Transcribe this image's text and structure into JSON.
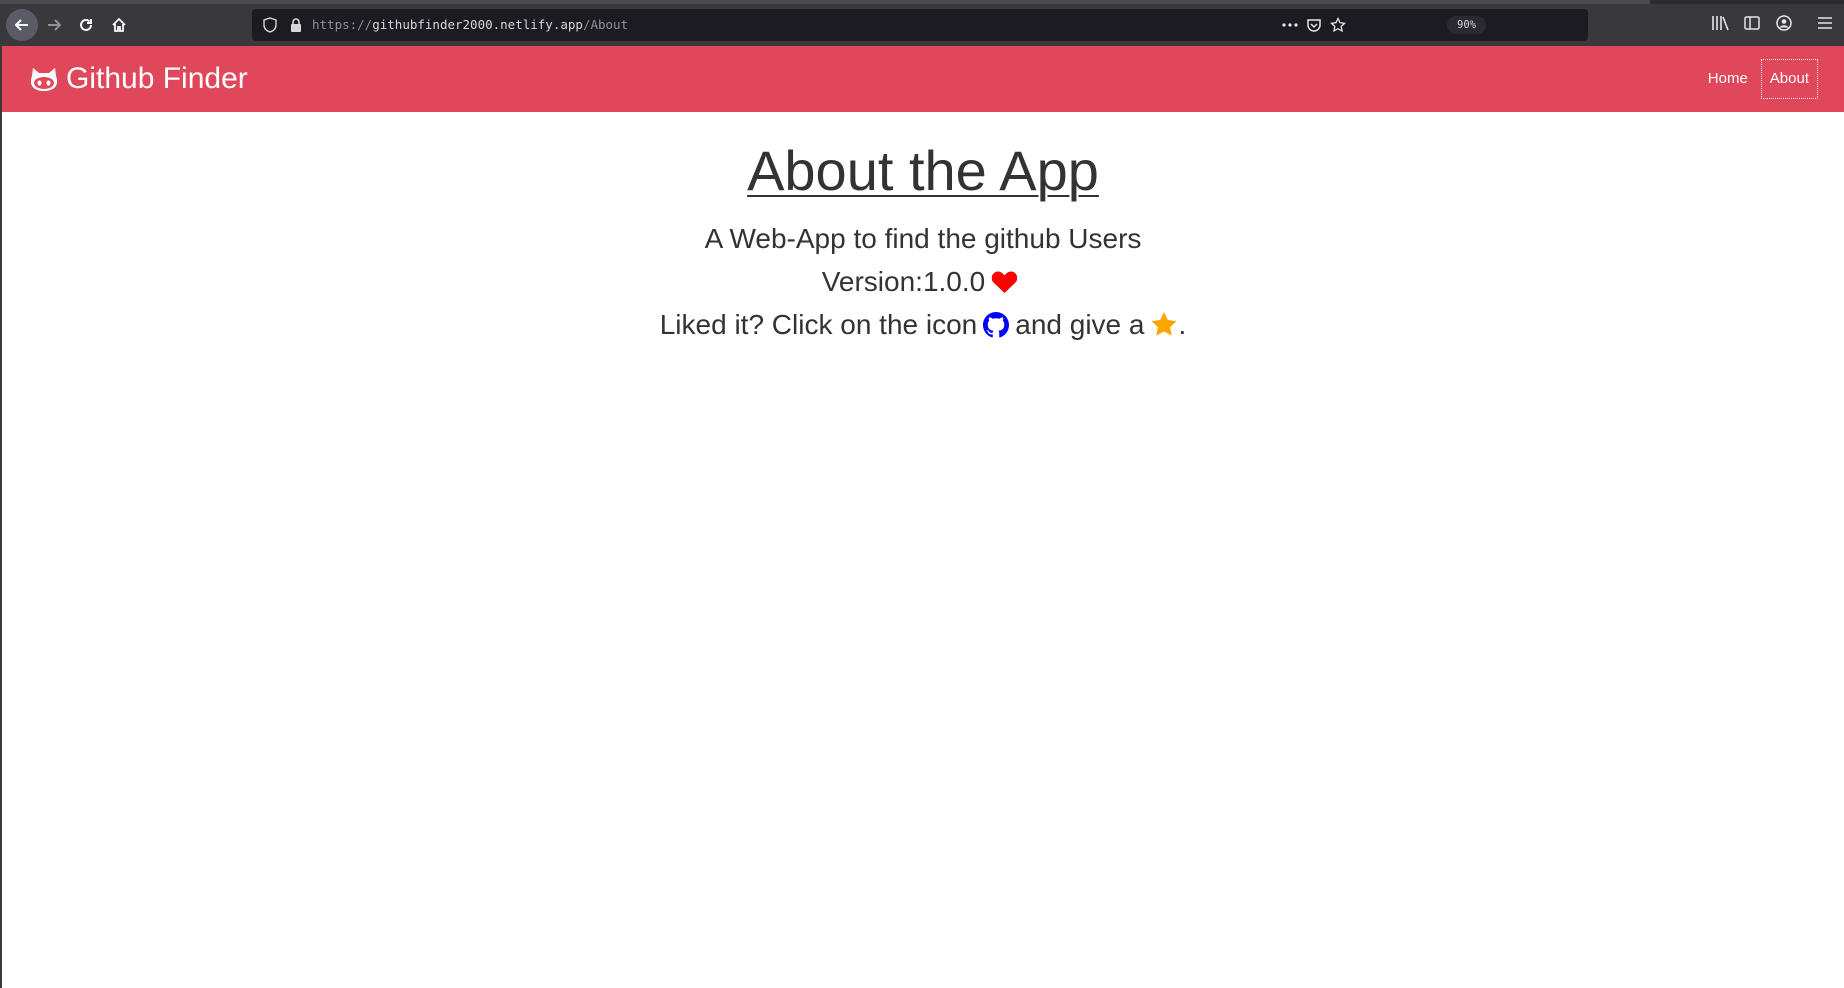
{
  "browser": {
    "url_scheme": "https://",
    "url_host": "githubfinder2000.netlify.app",
    "url_path": "/About",
    "zoom_label": "90%",
    "icons": [
      "back-icon",
      "forward-icon",
      "reload-icon",
      "home-icon",
      "shield-icon",
      "lock-icon",
      "more-icon",
      "pocket-icon",
      "star-icon",
      "library-icon",
      "sidebar-icon",
      "account-icon",
      "menu-icon"
    ]
  },
  "navbar": {
    "brand": "Github Finder",
    "brand_icon": "github-cat-icon",
    "background": "#e0475a",
    "links": [
      {
        "label": "Home"
      },
      {
        "label": "About",
        "active": true
      }
    ]
  },
  "main": {
    "title": "About the App",
    "description": "A Web-App to find the github Users",
    "version_text": "Version:1.0.0",
    "version_icon": "heart-icon",
    "liked_prefix": "Liked it? Click on the icon",
    "liked_middle": "and give a",
    "liked_suffix": ".",
    "github_icon_color": "#0000ff",
    "heart_color": "#ff0000",
    "star_color": "#ffa500"
  }
}
